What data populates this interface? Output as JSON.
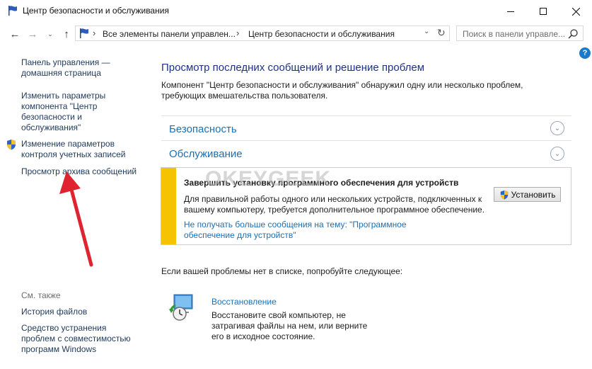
{
  "window": {
    "title": "Центр безопасности и обслуживания",
    "icon": "flag-icon",
    "minimize": "—",
    "maximize": "☐",
    "close": "✕"
  },
  "nav": {
    "back": "←",
    "forward": "→",
    "recent": "⌄",
    "up": "↑",
    "breadcrumb": [
      "Все элементы панели управлен...",
      "Центр безопасности и обслуживания"
    ],
    "breadcrumb_separator": "›",
    "dropdown": "⌄",
    "refresh": "↻",
    "search_placeholder": "Поиск в панели управле..."
  },
  "help": "?",
  "sidebar": {
    "home": "Панель управления — домашняя страница",
    "settings": "Изменить параметры компонента \"Центр безопасности и обслуживания\"",
    "uac": "Изменение параметров контроля учетных записей",
    "archive": "Просмотр архива сообщений",
    "see_also": "См. также",
    "history": "История файлов",
    "compat": "Средство устранения проблем с совместимостью программ Windows"
  },
  "main": {
    "title": "Просмотр последних сообщений и решение проблем",
    "description": "Компонент \"Центр безопасности и обслуживания\" обнаружил одну или несколько проблем, требующих вмешательства пользователя.",
    "security": "Безопасность",
    "maintenance": "Обслуживание",
    "chevron": "⌄",
    "alert": {
      "title": "Завершить установку программного обеспечения для устройств",
      "body": "Для правильной работы одного или нескольких устройств, подключенных к вашему компьютеру, требуется дополнительное программное обеспечение.",
      "link": "Не получать больше сообщения на тему: \"Программное обеспечение для устройств\"",
      "button": "Установить",
      "accent_color": "#f5c300"
    },
    "try_text": "Если вашей проблемы нет в списке, попробуйте следующее:",
    "restore": {
      "title": "Восстановление",
      "description": "Восстановите свой компьютер, не затрагивая файлы на нем, или верните его в исходное состояние."
    }
  },
  "watermark": "OKEYGEEK",
  "colors": {
    "link": "#1e6fb3",
    "title": "#1e3287",
    "annotation_arrow": "#e0242f"
  }
}
